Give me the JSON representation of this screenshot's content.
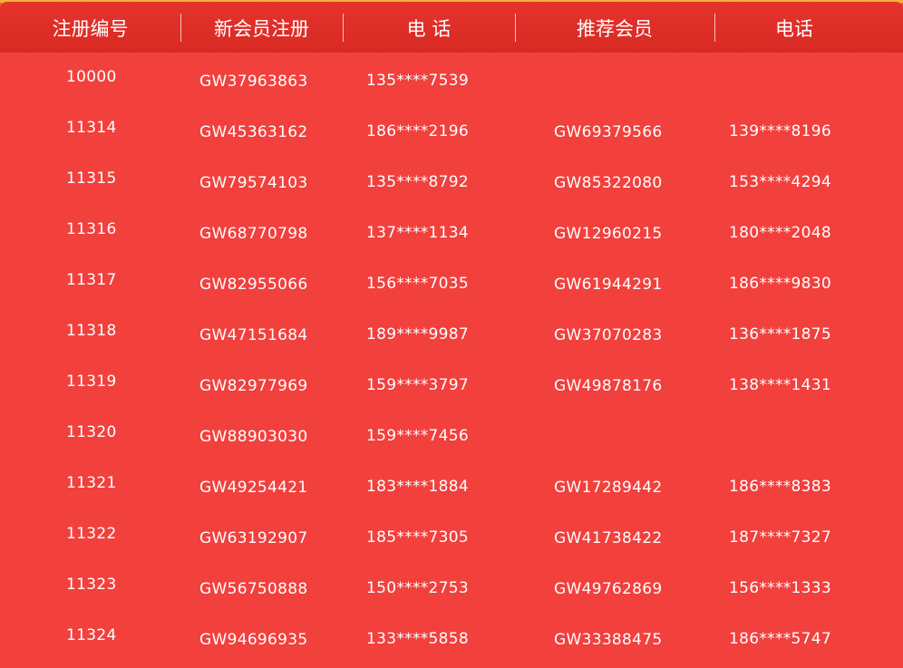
{
  "header": {
    "col_id": "注册编号",
    "col_new_member": "新会员注册",
    "col_phone": "电 话",
    "col_referrer": "推荐会员",
    "col_ref_phone": "电话"
  },
  "rows": [
    {
      "id": "10000",
      "member": "GW37963863",
      "phone": "135****7539",
      "referrer": "",
      "ref_phone": ""
    },
    {
      "id": "11314",
      "member": "GW45363162",
      "phone": "186****2196",
      "referrer": "GW69379566",
      "ref_phone": "139****8196"
    },
    {
      "id": "11315",
      "member": "GW79574103",
      "phone": "135****8792",
      "referrer": "GW85322080",
      "ref_phone": "153****4294"
    },
    {
      "id": "11316",
      "member": "GW68770798",
      "phone": "137****1134",
      "referrer": "GW12960215",
      "ref_phone": "180****2048"
    },
    {
      "id": "11317",
      "member": "GW82955066",
      "phone": "156****7035",
      "referrer": "GW61944291",
      "ref_phone": "186****9830"
    },
    {
      "id": "11318",
      "member": "GW47151684",
      "phone": "189****9987",
      "referrer": "GW37070283",
      "ref_phone": "136****1875"
    },
    {
      "id": "11319",
      "member": "GW82977969",
      "phone": "159****3797",
      "referrer": "GW49878176",
      "ref_phone": "138****1431"
    },
    {
      "id": "11320",
      "member": "GW88903030",
      "phone": "159****7456",
      "referrer": "",
      "ref_phone": ""
    },
    {
      "id": "11321",
      "member": "GW49254421",
      "phone": "183****1884",
      "referrer": "GW17289442",
      "ref_phone": "186****8383"
    },
    {
      "id": "11322",
      "member": "GW63192907",
      "phone": "185****7305",
      "referrer": "GW41738422",
      "ref_phone": "187****7327"
    },
    {
      "id": "11323",
      "member": "GW56750888",
      "phone": "150****2753",
      "referrer": "GW49762869",
      "ref_phone": "156****1333"
    },
    {
      "id": "11324",
      "member": "GW94696935",
      "phone": "133****5858",
      "referrer": "GW33388475",
      "ref_phone": "186****5747"
    }
  ]
}
